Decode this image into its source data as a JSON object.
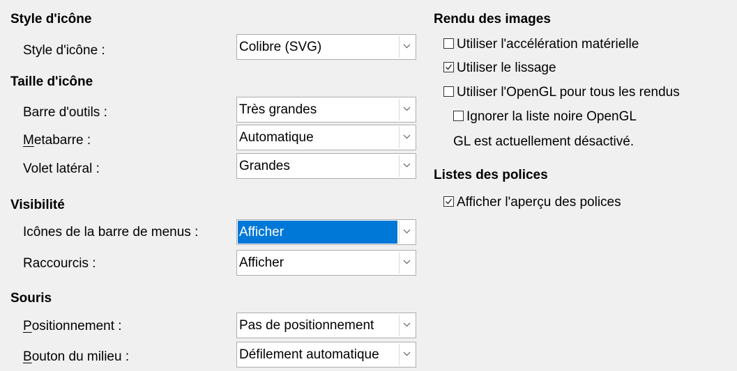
{
  "left": {
    "style_heading": "Style d'icône",
    "style_label": "Style d'icône :",
    "style_value": "Colibre (SVG)",
    "size_heading": "Taille d'icône",
    "toolbar_label": "Barre d'outils :",
    "toolbar_value": "Très grandes",
    "metabar_label": "Metabarre :",
    "metabar_value": "Automatique",
    "sidebar_label": "Volet latéral :",
    "sidebar_value": "Grandes",
    "visibility_heading": "Visibilité",
    "menu_icons_label": "Icônes de la barre de menus :",
    "menu_icons_value": "Afficher",
    "shortcuts_label": "Raccourcis :",
    "shortcuts_value": "Afficher",
    "mouse_heading": "Souris",
    "positioning_label": "Positionnement :",
    "positioning_value": "Pas de positionnement",
    "middle_button_label": "Bouton du milieu :",
    "middle_button_value": "Défilement automatique"
  },
  "right": {
    "rendering_heading": "Rendu des images",
    "hw_accel_label": "Utiliser l'accélération matérielle",
    "hw_accel_checked": false,
    "antialias_label": "Utiliser le lissage",
    "antialias_checked": true,
    "opengl_label": "Utiliser l'OpenGL pour tous les rendus",
    "opengl_checked": false,
    "blacklist_label": "Ignorer la liste noire OpenGL",
    "blacklist_checked": false,
    "gl_status": "GL est actuellement désactivé.",
    "fonts_heading": "Listes des polices",
    "font_preview_label": "Afficher l'aperçu des polices",
    "font_preview_checked": true
  },
  "colors": {
    "selection": "#0078d7",
    "background": "#f0f0f0"
  }
}
